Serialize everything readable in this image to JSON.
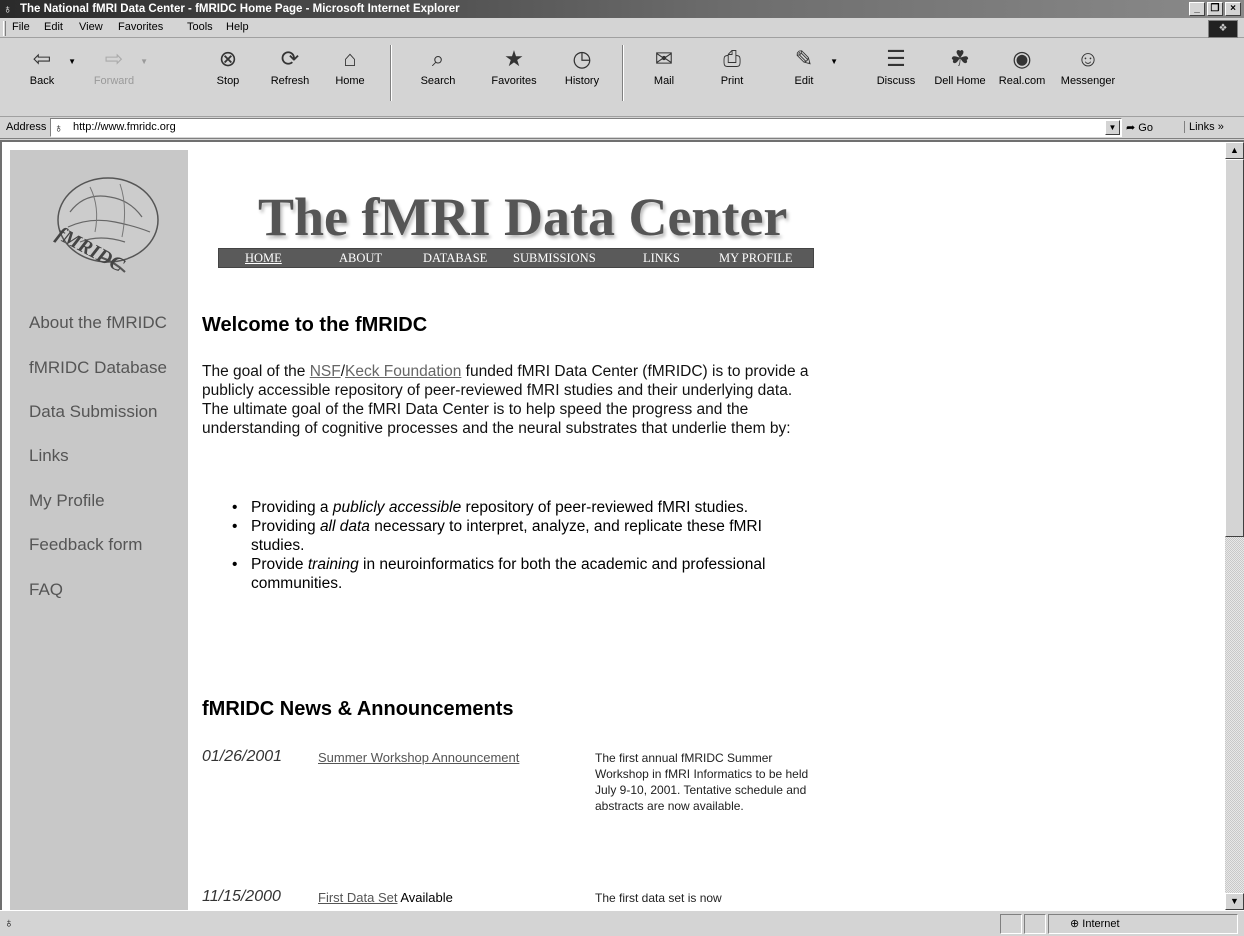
{
  "window": {
    "title": "The National fMRI Data Center - fMRIDC Home Page - Microsoft Internet Explorer",
    "controls": [
      "_",
      "❒",
      "×"
    ]
  },
  "menu": {
    "items": [
      "File",
      "Edit",
      "View",
      "Favorites",
      "Tools",
      "Help"
    ]
  },
  "toolbar": {
    "back": "Back",
    "forward": "Forward",
    "stop": "Stop",
    "refresh": "Refresh",
    "home": "Home",
    "search": "Search",
    "favorites": "Favorites",
    "history": "History",
    "mail": "Mail",
    "print": "Print",
    "edit": "Edit",
    "discuss": "Discuss",
    "dell_home": "Dell Home",
    "realcom": "Real.com",
    "messenger": "Messenger"
  },
  "address": {
    "label": "Address",
    "url": "http://www.fmridc.org",
    "go": "Go",
    "links": "Links"
  },
  "sidebar": {
    "logo_text": "fMRIDC",
    "items": [
      "About the fMRIDC",
      "fMRIDC Database",
      "Data Submission",
      "Links",
      "My Profile",
      "Feedback form",
      "FAQ"
    ]
  },
  "banner": {
    "title": "The fMRI Data Center",
    "nav": [
      "HOME",
      "ABOUT",
      "DATABASE",
      "SUBMISSIONS",
      "LINKS",
      "MY PROFILE"
    ]
  },
  "welcome": {
    "heading": "Welcome to the fMRIDC",
    "intro_prefix": "The goal of the ",
    "link_nsf": "NSF",
    "slash": "/",
    "link_keck": "Keck Foundation",
    "intro_rest": " funded fMRI Data Center (fMRIDC) is to provide a publicly accessible repository of peer-reviewed fMRI studies and their underlying data. The ultimate goal of the fMRI Data Center is to help speed the progress and the understanding of cognitive processes and the neural substrates that underlie them by:",
    "bullets": [
      {
        "pre": "Providing a ",
        "em": "publicly accessible",
        "post": " repository of peer-reviewed fMRI studies."
      },
      {
        "pre": "Providing ",
        "em": "all data",
        "post": " necessary to interpret, analyze, and replicate these fMRI studies."
      },
      {
        "pre": "Provide ",
        "em": "training",
        "post": " in neuroinformatics for both the academic and professional communities."
      }
    ]
  },
  "news": {
    "heading": "fMRIDC News & Announcements",
    "items": [
      {
        "date": "01/26/2001",
        "title": "Summer Workshop Announcement",
        "title_suffix": "",
        "desc": "The first annual fMRIDC Summer Workshop in fMRI Informatics to be held July 9-10, 2001. Tentative schedule and abstracts are now available."
      },
      {
        "date": "11/15/2000",
        "title": "First Data Set",
        "title_suffix": " Available",
        "desc": "The first data set is now"
      }
    ]
  },
  "status": {
    "zone": "Internet"
  }
}
